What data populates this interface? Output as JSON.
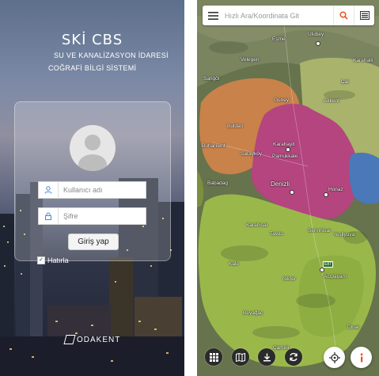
{
  "login": {
    "brand": "SKİ CBS",
    "subtitle_line1": "SU VE KANALİZASYON İDARESİ",
    "subtitle_line2": "COĞRAFİ BİLGİ SİSTEMİ",
    "username_placeholder": "Kullanıcı adı",
    "password_placeholder": "Şifre",
    "login_button": "Giriş yap",
    "remember_label": "Hatırla",
    "remember_checked": true,
    "footer_logo": "ODAKENT"
  },
  "map": {
    "search_placeholder": "Hızlı Ara/Koordinata Git",
    "places": [
      {
        "name": "Ulubey"
      },
      {
        "name": "Eşme"
      },
      {
        "name": "Velegen"
      },
      {
        "name": "Karahalli"
      },
      {
        "name": "Sarigöl"
      },
      {
        "name": "Çal"
      },
      {
        "name": "Güney"
      },
      {
        "name": "Akkent"
      },
      {
        "name": "Buldan"
      },
      {
        "name": "Buharkent"
      },
      {
        "name": "Sarayköy"
      },
      {
        "name": "Karahayit"
      },
      {
        "name": "Pamukkale"
      },
      {
        "name": "Babadag"
      },
      {
        "name": "Denizli"
      },
      {
        "name": "Honaz"
      },
      {
        "name": "Karahisar"
      },
      {
        "name": "Tavas"
      },
      {
        "name": "Serinhisar"
      },
      {
        "name": "Yeşilyuva"
      },
      {
        "name": "Kale"
      },
      {
        "name": "Nikfer"
      },
      {
        "name": "Acıpayam"
      },
      {
        "name": "Beyağaç"
      },
      {
        "name": "Çameli"
      },
      {
        "name": "Dinar"
      }
    ],
    "road_labels": [
      "E87"
    ],
    "colors": {
      "accent": "#e8541e",
      "region_orange": "#c9824a",
      "region_magenta": "#b4457f",
      "region_green": "#9ab84a",
      "region_blue": "#4a78b8"
    }
  }
}
